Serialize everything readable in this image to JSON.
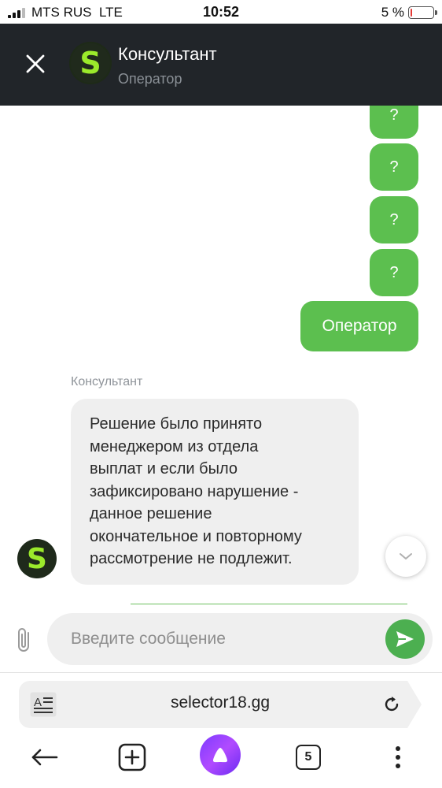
{
  "status_bar": {
    "carrier": "MTS RUS  LTE",
    "time": "10:52",
    "battery": "5 %",
    "battery_level": 0.05,
    "battery_color": "#e53935"
  },
  "header": {
    "close_icon": "close-icon",
    "avatar_letter": "S",
    "title": "Консультант",
    "subtitle": "Оператор",
    "background": "#212529",
    "avatar_color": "#9bea2b"
  },
  "messages": {
    "outgoing": [
      {
        "text": "?"
      },
      {
        "text": "?"
      },
      {
        "text": "?"
      },
      {
        "text": "?"
      },
      {
        "text": "Оператор"
      }
    ],
    "incoming": {
      "sender": "Консультант",
      "avatar_letter": "S",
      "lines": [
        "Решение было принято",
        "менеджером из отдела",
        "выплат и если было",
        "зафиксировано нарушение -",
        "данное решение",
        "окончательное и повторному",
        "рассмотрение не подлежит."
      ]
    },
    "outgoing_color": "#5cbf4f",
    "incoming_color": "#efefef"
  },
  "composer": {
    "placeholder": "Введите сообщение",
    "attach_icon": "paperclip-icon",
    "send_icon": "send-arrow-icon",
    "send_color": "#4caf50"
  },
  "browser": {
    "url": "selector18.gg",
    "reader_icon": "reader-mode-icon",
    "reload_icon": "reload-icon",
    "tabs_count": "5",
    "nav_icons": [
      "back-arrow-icon",
      "new-tab-icon",
      "alice-assistant-icon",
      "tabs-icon",
      "more-menu-icon"
    ]
  }
}
